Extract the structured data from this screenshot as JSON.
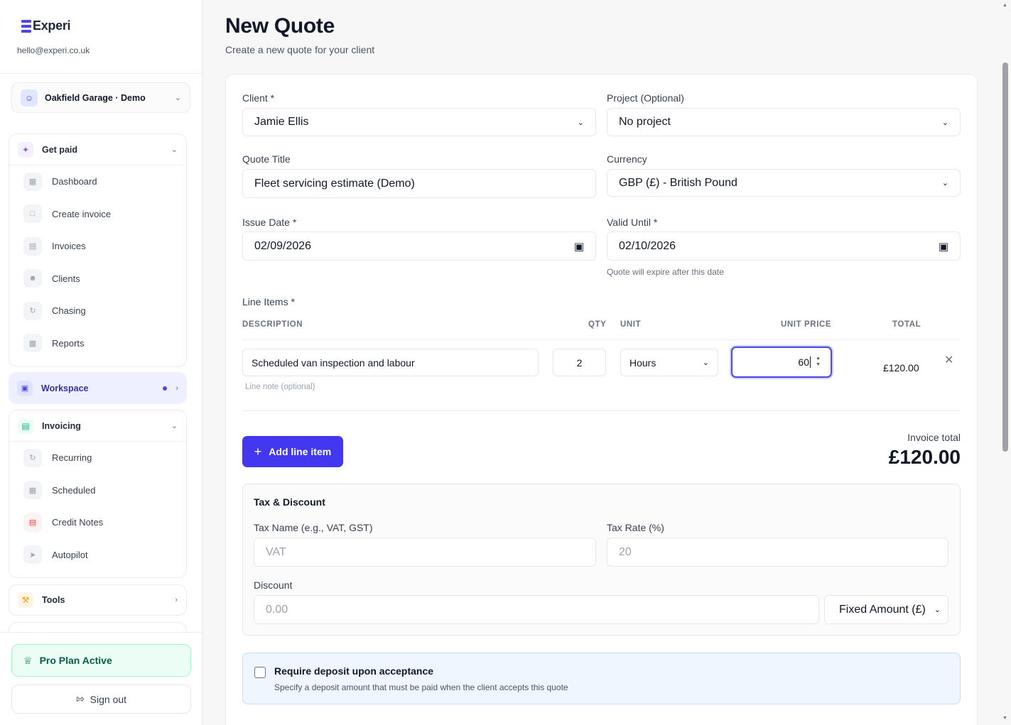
{
  "sidebar": {
    "brand": "Experi",
    "email": "hello@experi.co.uk",
    "org": "Oakfield Garage · Demo",
    "get_paid": {
      "label": "Get paid",
      "items": [
        {
          "label": "Dashboard",
          "icon": "grid-icon"
        },
        {
          "label": "Create invoice",
          "icon": "document-plus-icon"
        },
        {
          "label": "Invoices",
          "icon": "document-icon"
        },
        {
          "label": "Clients",
          "icon": "users-icon"
        },
        {
          "label": "Chasing",
          "icon": "refresh-icon"
        },
        {
          "label": "Reports",
          "icon": "bar-chart-icon"
        }
      ]
    },
    "workspace": "Workspace",
    "invoicing": {
      "label": "Invoicing",
      "items": [
        {
          "label": "Recurring",
          "icon": "refresh-icon"
        },
        {
          "label": "Scheduled",
          "icon": "calendar-icon"
        },
        {
          "label": "Credit Notes",
          "icon": "credit-note-icon"
        },
        {
          "label": "Autopilot",
          "icon": "rocket-icon"
        }
      ]
    },
    "tools": "Tools",
    "pro_plan": "Pro Plan Active",
    "sign_out": "Sign out"
  },
  "page": {
    "title": "New Quote",
    "subtitle": "Create a new quote for your client"
  },
  "form": {
    "client_label": "Client *",
    "client_value": "Jamie Ellis",
    "project_label": "Project (Optional)",
    "project_value": "No project",
    "title_label": "Quote Title",
    "title_value": "Fleet servicing estimate (Demo)",
    "currency_label": "Currency",
    "currency_value": "GBP (£) - British Pound",
    "issue_label": "Issue Date *",
    "issue_value": "02/09/2026",
    "valid_label": "Valid Until *",
    "valid_value": "02/10/2026",
    "valid_hint": "Quote will expire after this date"
  },
  "line_items": {
    "label": "Line Items *",
    "headers": {
      "description": "DESCRIPTION",
      "qty": "QTY",
      "unit": "UNIT",
      "unit_price": "UNIT PRICE",
      "total": "TOTAL"
    },
    "row": {
      "description": "Scheduled van inspection and labour",
      "qty": "2",
      "unit": "Hours",
      "unit_price": "60",
      "total": "£120.00",
      "note_placeholder": "Line note (optional)"
    },
    "add_label": "Add line item",
    "total_label": "Invoice total",
    "total_value": "£120.00"
  },
  "tax": {
    "title": "Tax & Discount",
    "name_label": "Tax Name (e.g., VAT, GST)",
    "name_placeholder": "VAT",
    "rate_label": "Tax Rate (%)",
    "rate_placeholder": "20",
    "discount_label": "Discount",
    "discount_placeholder": "0.00",
    "discount_type": "Fixed Amount (£)"
  },
  "deposit": {
    "title": "Require deposit upon acceptance",
    "subtitle": "Specify a deposit amount that must be paid when the client accepts this quote"
  },
  "colors": {
    "accent": "#4338f0",
    "pro": "#065f46"
  }
}
